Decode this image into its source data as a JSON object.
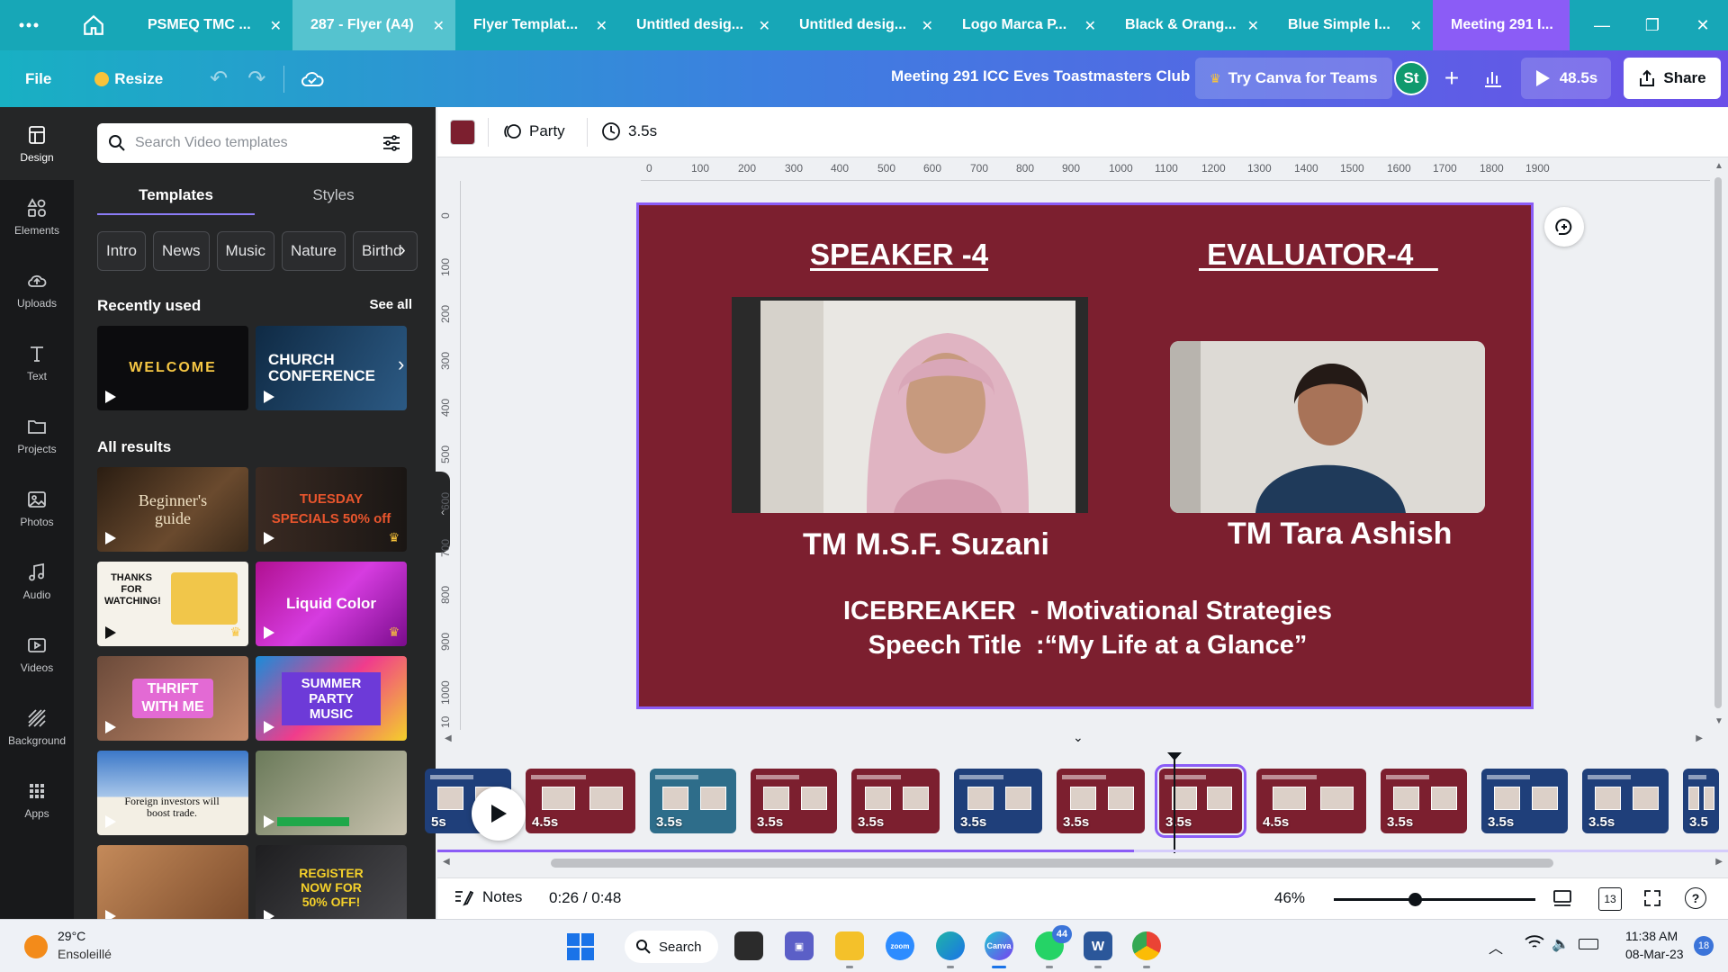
{
  "browser": {
    "tabs": [
      {
        "label": "PSMEQ TMC ...",
        "close": "✕"
      },
      {
        "label": "287 - Flyer (A4)",
        "close": "✕"
      },
      {
        "label": "Flyer Templat...",
        "close": "✕"
      },
      {
        "label": "Untitled desig...",
        "close": "✕"
      },
      {
        "label": "Untitled desig...",
        "close": "✕"
      },
      {
        "label": "Logo Marca P...",
        "close": "✕"
      },
      {
        "label": "Black & Orang...",
        "close": "✕"
      },
      {
        "label": "Blue Simple I...",
        "close": "✕"
      },
      {
        "label": "Meeting 291 I..."
      }
    ],
    "more_icon": "three-dots-icon",
    "home_icon": "home-icon"
  },
  "header": {
    "file": "File",
    "resize": "Resize",
    "doc_title": "Meeting 291 ICC Eves Toastmasters Club",
    "try_teams": "Try Canva for Teams",
    "avatar_initials": "St",
    "play_duration": "48.5s",
    "share": "Share"
  },
  "leftnav": {
    "items": [
      {
        "label": "Design",
        "icon": "design-icon"
      },
      {
        "label": "Elements",
        "icon": "elements-icon"
      },
      {
        "label": "Uploads",
        "icon": "uploads-icon"
      },
      {
        "label": "Text",
        "icon": "text-icon"
      },
      {
        "label": "Projects",
        "icon": "projects-icon"
      },
      {
        "label": "Photos",
        "icon": "photos-icon"
      },
      {
        "label": "Audio",
        "icon": "audio-icon"
      },
      {
        "label": "Videos",
        "icon": "videos-icon"
      },
      {
        "label": "Background",
        "icon": "background-icon"
      },
      {
        "label": "Apps",
        "icon": "apps-icon"
      }
    ]
  },
  "panel": {
    "search_placeholder": "Search Video templates",
    "tabs": [
      "Templates",
      "Styles"
    ],
    "chips": [
      "Intro",
      "News",
      "Music",
      "Nature",
      "Birthd"
    ],
    "recently_used": "Recently used",
    "see_all": "See all",
    "recent": [
      {
        "text": "WELCOME"
      },
      {
        "text": "CHURCH CONFERENCE"
      }
    ],
    "all_results": "All results",
    "results": [
      {
        "text": "Beginner's guide"
      },
      {
        "text": "TUESDAY SPECIALS 50% off"
      },
      {
        "text": "THANKS FOR WATCHING!"
      },
      {
        "text": "Liquid Color"
      },
      {
        "text": "THRIFT WITH ME"
      },
      {
        "text": "SUMMER PARTY MUSIC"
      },
      {
        "text": "Foreign investors will boost trade."
      },
      {
        "text": ""
      },
      {
        "text": ""
      },
      {
        "text": "REGISTER NOW FOR 50% OFF!"
      }
    ]
  },
  "toolbar": {
    "color": "#7c1f2f",
    "animation": "Party",
    "duration": "3.5s"
  },
  "ruler": {
    "h_ticks": [
      "0",
      "100",
      "200",
      "300",
      "400",
      "500",
      "600",
      "700",
      "800",
      "900",
      "1000",
      "1100",
      "1200",
      "1300",
      "1400",
      "1500",
      "1600",
      "1700",
      "1800",
      "1900"
    ],
    "v_ticks": [
      "0",
      "100",
      "200",
      "300",
      "400",
      "500",
      "600",
      "700",
      "800",
      "900",
      "1000",
      "10"
    ]
  },
  "slide": {
    "speaker_title": "SPEAKER -4",
    "evaluator_title": " EVALUATOR-4   ",
    "speaker_name": "TM M.S.F. Suzani",
    "evaluator_name": "TM Tara Ashish",
    "line1": "ICEBREAKER  - Motivational Strategies",
    "line2": "Speech Title  :“My Life at a Glance”",
    "background": "#7c1f2f"
  },
  "timeline": {
    "items": [
      {
        "duration": "5s",
        "color": "#1f3f7a"
      },
      {
        "duration": "4.5s",
        "color": "#7c1f2f"
      },
      {
        "duration": "3.5s",
        "color": "#2e6d8a"
      },
      {
        "duration": "3.5s",
        "color": "#7c1f2f"
      },
      {
        "duration": "3.5s",
        "color": "#7c1f2f"
      },
      {
        "duration": "3.5s",
        "color": "#1f3f7a"
      },
      {
        "duration": "3.5s",
        "color": "#7c1f2f"
      },
      {
        "duration": "3.5s",
        "color": "#7c1f2f"
      },
      {
        "duration": "4.5s",
        "color": "#7c1f2f"
      },
      {
        "duration": "3.5s",
        "color": "#7c1f2f"
      },
      {
        "duration": "3.5s",
        "color": "#1f3f7a"
      },
      {
        "duration": "3.5s",
        "color": "#1f3f7a"
      },
      {
        "duration": "3.5",
        "color": "#1f3f7a"
      }
    ],
    "progress": 0.54
  },
  "footer": {
    "notes": "Notes",
    "time": "0:26 / 0:48",
    "zoom": "46%",
    "zoom_fraction": 0.4,
    "page_count": "13"
  },
  "taskbar": {
    "temperature": "29°C",
    "weather": "Ensoleillé",
    "search": "Search",
    "whatsapp_badge": "44",
    "time": "11:38 AM",
    "date": "08-Mar-23",
    "notification_count": "18"
  }
}
